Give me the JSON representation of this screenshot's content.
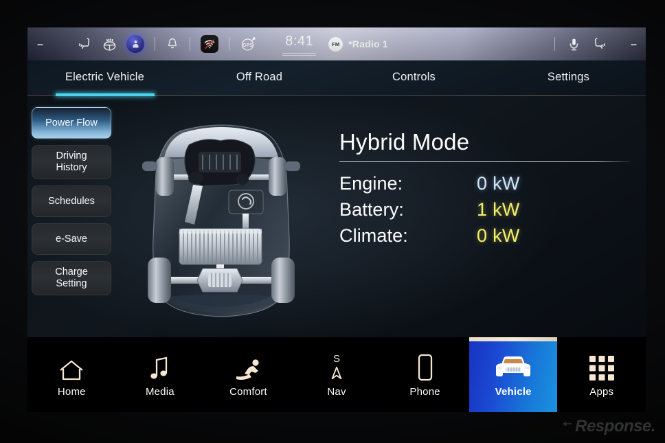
{
  "statusbar": {
    "left_placeholder": "--",
    "right_placeholder": "--",
    "icons_left": [
      "heated-seat-icon",
      "heated-steering-wheel-icon",
      "driver-profile-avatar-icon",
      "notification-bell-icon",
      "wifi-off-icon",
      "gps-icon"
    ],
    "time": "8:41",
    "fm_badge": "FM",
    "radio_station": "*Radio 1",
    "icons_right": [
      "microphone-icon",
      "heated-seat-passenger-icon"
    ]
  },
  "tabs": [
    {
      "label": "Electric Vehicle",
      "active": true
    },
    {
      "label": "Off Road",
      "active": false
    },
    {
      "label": "Controls",
      "active": false
    },
    {
      "label": "Settings",
      "active": false
    }
  ],
  "sidebar": {
    "items": [
      {
        "label": "Power Flow",
        "selected": true
      },
      {
        "label": "Driving History",
        "selected": false
      },
      {
        "label": "Schedules",
        "selected": false
      },
      {
        "label": "e-Save",
        "selected": false
      },
      {
        "label": "Charge Setting",
        "selected": false
      }
    ]
  },
  "powerflow": {
    "illustration": "hybrid-powertrain-top-view",
    "mode_title": "Hybrid Mode",
    "stats": [
      {
        "label": "Engine:",
        "value": "0 kW",
        "color": "#cfe6f8"
      },
      {
        "label": "Battery:",
        "value": "1 kW",
        "color": "#f3f06a"
      },
      {
        "label": "Climate:",
        "value": "0 kW",
        "color": "#f3f06a"
      }
    ]
  },
  "navbar": {
    "items": [
      {
        "label": "Home",
        "icon": "home-icon",
        "active": false
      },
      {
        "label": "Media",
        "icon": "music-note-icon",
        "active": false
      },
      {
        "label": "Comfort",
        "icon": "reclined-seat-icon",
        "active": false
      },
      {
        "label": "Nav",
        "icon": "compass-arrow-icon",
        "heading": "S",
        "active": false
      },
      {
        "label": "Phone",
        "icon": "smartphone-icon",
        "active": false
      },
      {
        "label": "Vehicle",
        "icon": "suv-front-icon",
        "active": true
      },
      {
        "label": "Apps",
        "icon": "grid-apps-icon",
        "active": false
      }
    ]
  },
  "watermark": {
    "text": "Response."
  },
  "colors": {
    "accent_cyan": "#4cd3ec",
    "active_tile_blue": "#1878d8",
    "value_blue": "#cfe6f8",
    "value_yellow": "#f3f06a",
    "screen_bg": "#0c1218"
  }
}
